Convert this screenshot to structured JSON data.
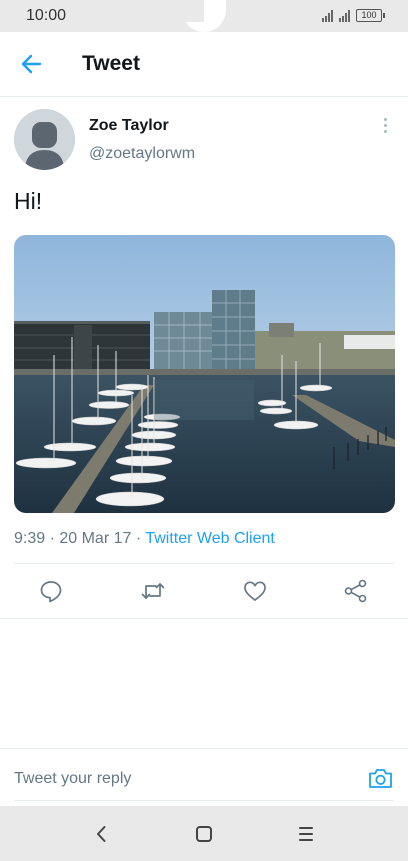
{
  "status": {
    "time": "10:00",
    "battery": "100"
  },
  "header": {
    "title": "Tweet",
    "back_icon": "arrow-left-icon"
  },
  "tweet": {
    "user_name": "Zoe Taylor",
    "user_handle": "@zoetaylorwm",
    "text": "Hi!",
    "timestamp": "9:39 · 20 Mar 17 · ",
    "source": "Twitter Web Client"
  },
  "actions": [
    "reply-icon",
    "retweet-icon",
    "like-icon",
    "share-icon"
  ],
  "reply": {
    "placeholder": "Tweet your reply"
  },
  "colors": {
    "accent": "#1da1f2",
    "secondary_text": "#657786",
    "divider": "#e6ecf0"
  }
}
